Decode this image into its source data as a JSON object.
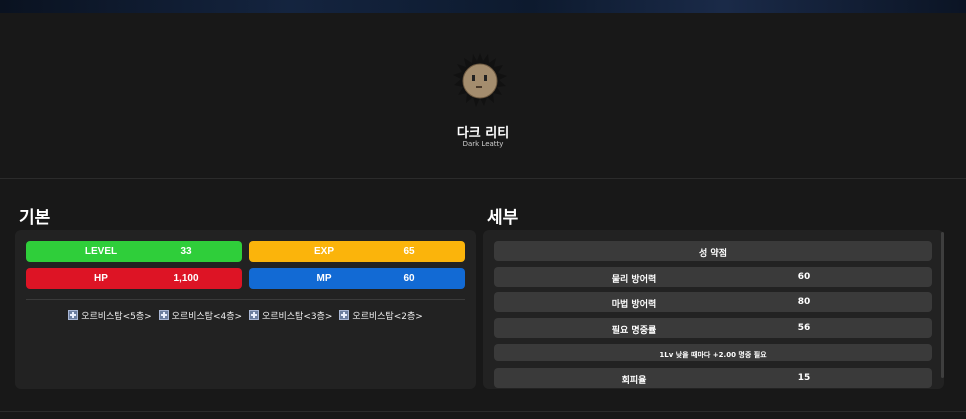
{
  "monster": {
    "name_kr": "다크 리티",
    "name_en": "Dark Leatty",
    "sprite_icon": "dark-leatty-sprite"
  },
  "basic": {
    "title": "기본",
    "stats": [
      {
        "label": "LEVEL",
        "value": "33",
        "color": "#2fce3a"
      },
      {
        "label": "EXP",
        "value": "65",
        "color": "#fbb40b"
      },
      {
        "label": "HP",
        "value": "1,100",
        "color": "#dd1425"
      },
      {
        "label": "MP",
        "value": "60",
        "color": "#126ad4"
      }
    ],
    "locations": [
      "오르비스탑<5층>",
      "오르비스탑<4층>",
      "오르비스탑<3층>",
      "오르비스탑<2층>"
    ],
    "location_icon": "map-icon"
  },
  "detail": {
    "title": "세부",
    "rows": [
      {
        "label": "성 약점",
        "value": ""
      },
      {
        "label": "물리 방어력",
        "value": "60"
      },
      {
        "label": "마법 방어력",
        "value": "80"
      },
      {
        "label": "필요 명중률",
        "value": "56"
      },
      {
        "label": "1Lv 낮을 때마다 +2.00 명중 필요",
        "value": ""
      },
      {
        "label": "회피율",
        "value": "15"
      }
    ]
  }
}
